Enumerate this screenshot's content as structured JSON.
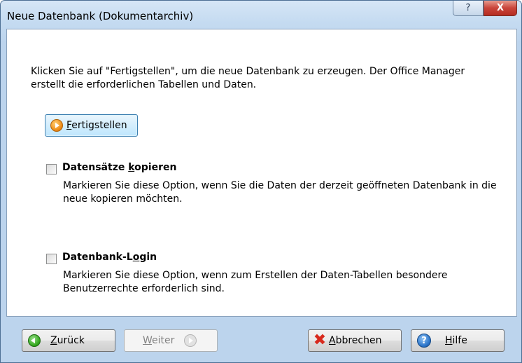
{
  "window": {
    "title": "Neue Datenbank (Dokumentarchiv)",
    "help_glyph": "?",
    "close_glyph": "X"
  },
  "intro": {
    "text": "Klicken Sie auf \"Fertigstellen\", um die neue Datenbank zu erzeugen. Der Office Manager erstellt die erforderlichen Tabellen und Daten."
  },
  "finish_button": {
    "mnemonic": "F",
    "rest": "ertigstellen"
  },
  "options": [
    {
      "label_pre": "Datensätze ",
      "label_mnemonic": "k",
      "label_post": "opieren",
      "checked": false,
      "description": "Markieren Sie diese Option, wenn Sie die Daten der derzeit geöffneten Datenbank in die neue kopieren möchten."
    },
    {
      "label_pre": "Datenbank-L",
      "label_mnemonic": "o",
      "label_post": "gin",
      "checked": false,
      "description": "Markieren Sie diese Option, wenn zum Erstellen der Daten-Tabellen besondere Benutzerrechte erforderlich sind."
    }
  ],
  "footer": {
    "back": {
      "mnemonic": "Z",
      "rest": "urück"
    },
    "next": {
      "mnemonic": "W",
      "rest": "eiter"
    },
    "cancel": {
      "mnemonic": "A",
      "rest": "bbrechen"
    },
    "help": {
      "mnemonic": "H",
      "rest": "ilfe",
      "icon_glyph": "?"
    }
  },
  "colors": {
    "accent_orange": "#f0901c",
    "back_green": "#34a81e",
    "cancel_red": "#d8291c",
    "help_blue": "#2a74c9"
  },
  "icons": [
    "orange-play-icon",
    "green-back-arrow-icon",
    "gray-forward-arrow-icon",
    "red-x-icon",
    "blue-help-icon"
  ]
}
